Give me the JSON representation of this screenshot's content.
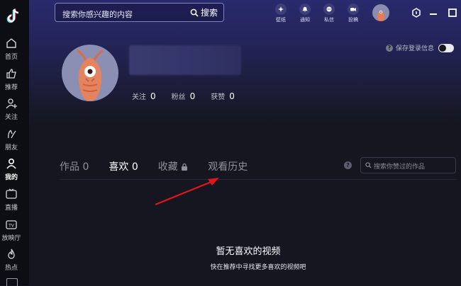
{
  "sidebar": {
    "items": [
      {
        "label": "首页"
      },
      {
        "label": "推荐"
      },
      {
        "label": "关注"
      },
      {
        "label": "朋友"
      },
      {
        "label": "我的"
      },
      {
        "label": "直播"
      },
      {
        "label": "放映厅"
      },
      {
        "label": "热点"
      }
    ]
  },
  "header": {
    "search_placeholder": "搜索你感兴趣的内容",
    "search_button": "搜索",
    "icons": [
      {
        "label": "壁纸"
      },
      {
        "label": "通知"
      },
      {
        "label": "私信"
      },
      {
        "label": "投稿"
      }
    ]
  },
  "profile": {
    "stats": [
      {
        "label": "关注",
        "value": "0"
      },
      {
        "label": "粉丝",
        "value": "0"
      },
      {
        "label": "获赞",
        "value": "0"
      }
    ],
    "save_login_label": "保存登录信息"
  },
  "tabs": [
    {
      "label": "作品",
      "count": "0"
    },
    {
      "label": "喜欢",
      "count": "0"
    },
    {
      "label": "收藏",
      "count": ""
    },
    {
      "label": "观看历史",
      "count": ""
    }
  ],
  "liked_search": {
    "placeholder": "搜索你赞过的作品"
  },
  "empty_state": {
    "title": "暂无喜欢的视频",
    "subtitle": "快在推荐中寻找更多喜欢的视频吧"
  },
  "colors": {
    "accent": "#2a2b6e",
    "background": "#15161f",
    "annotation_arrow": "#e0161a"
  }
}
